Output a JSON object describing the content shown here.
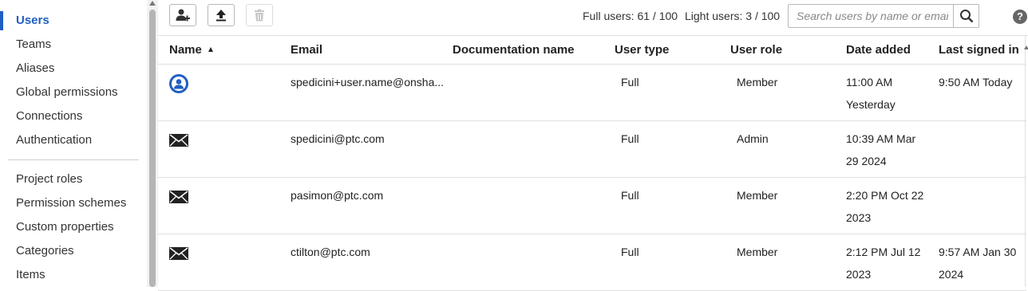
{
  "sidebar": {
    "group1": [
      {
        "label": "Users",
        "active": true
      },
      {
        "label": "Teams"
      },
      {
        "label": "Aliases"
      },
      {
        "label": "Global permissions"
      },
      {
        "label": "Connections"
      },
      {
        "label": "Authentication"
      }
    ],
    "group2": [
      {
        "label": "Project roles"
      },
      {
        "label": "Permission schemes"
      },
      {
        "label": "Custom properties"
      },
      {
        "label": "Categories"
      },
      {
        "label": "Items"
      }
    ]
  },
  "toolbar": {
    "add_user_icon": "add-user-icon",
    "upload_icon": "upload-icon",
    "delete_icon": "trash-icon",
    "full_users": "Full users: 61 / 100",
    "light_users": "Light users: 3 / 100",
    "search_placeholder": "Search users by name or email",
    "search_value": "",
    "help": "?"
  },
  "table": {
    "columns": {
      "name": "Name",
      "email": "Email",
      "doc_name": "Documentation name",
      "user_type": "User type",
      "user_role": "User role",
      "date_added": "Date added",
      "last_signed": "Last signed in"
    },
    "sorted_by": "Name",
    "rows": [
      {
        "icon": "user-avatar-icon",
        "email": "spedicini+user.name@onsha...",
        "doc_name": "",
        "type": "Full",
        "role": "Member",
        "date_added": "11:00 AM Yesterday",
        "last_signed": "9:50 AM Today"
      },
      {
        "icon": "envelope-icon",
        "email": "spedicini@ptc.com",
        "doc_name": "",
        "type": "Full",
        "role": "Admin",
        "date_added": "10:39 AM Mar 29 2024",
        "last_signed": ""
      },
      {
        "icon": "envelope-icon",
        "email": "pasimon@ptc.com",
        "doc_name": "",
        "type": "Full",
        "role": "Member",
        "date_added": "2:20 PM Oct 22 2023",
        "last_signed": ""
      },
      {
        "icon": "envelope-icon",
        "email": "ctilton@ptc.com",
        "doc_name": "",
        "type": "Full",
        "role": "Member",
        "date_added": "2:12 PM Jul 12 2023",
        "last_signed": "9:57 AM Jan 30 2024"
      }
    ]
  },
  "colors": {
    "accent": "#1f5fc4",
    "avatar": "#1f5fc4"
  }
}
